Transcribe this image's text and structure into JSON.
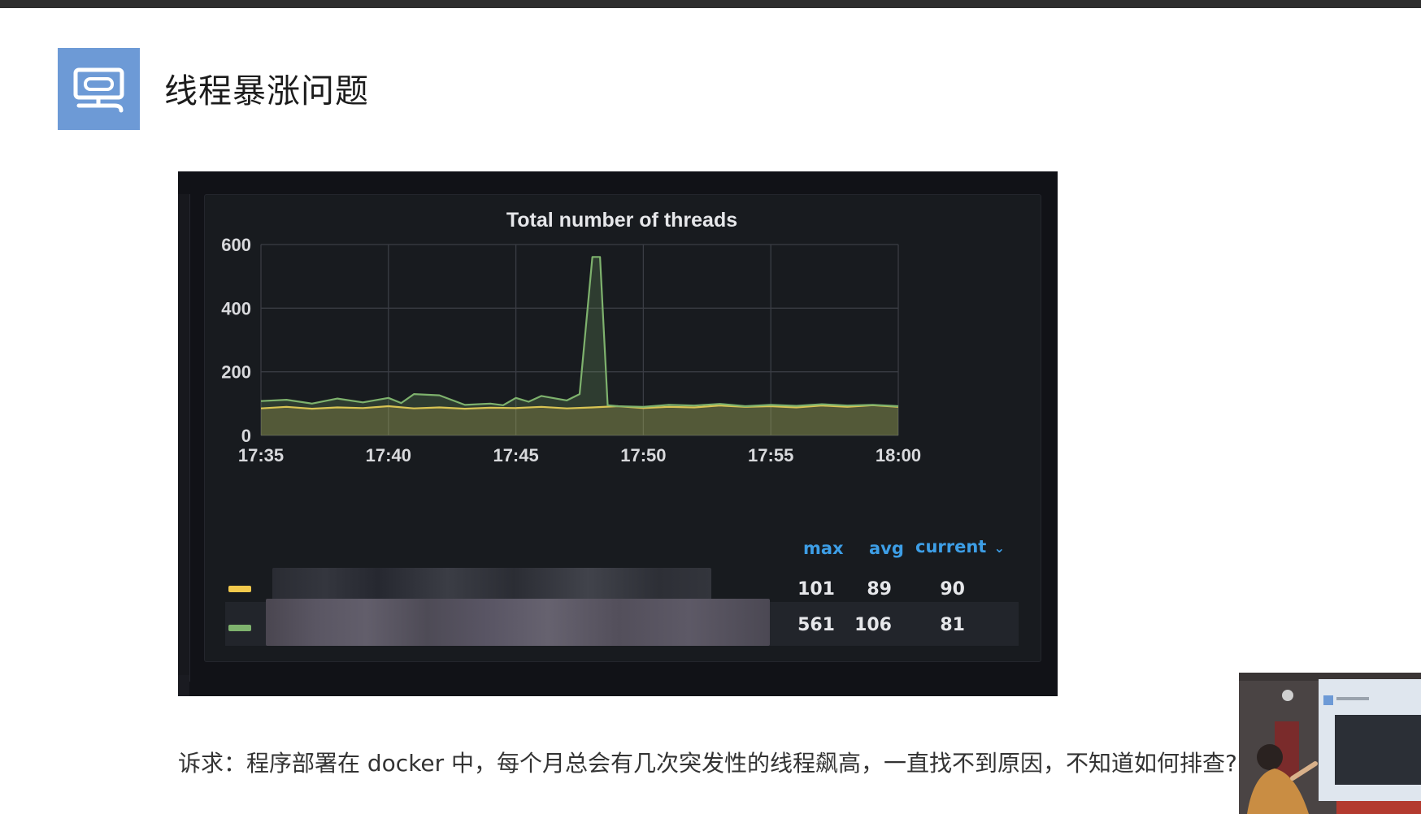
{
  "slide": {
    "title": "线程暴涨问题",
    "caption": "诉求：程序部署在 docker 中，每个月总会有几次突发性的线程飙高，一直找不到原因，不知道如何排查?"
  },
  "colors": {
    "logo_bg": "#6d9ad6",
    "dashboard_bg": "#111217",
    "panel_bg": "#181b1f",
    "series_yellow": "#f2c94c",
    "series_green": "#7eb26d",
    "legend_header": "#3d9ee6"
  },
  "icons": {
    "logo": "presentation-board-icon",
    "dropdown": "chevron-down-icon"
  },
  "legend": {
    "columns": [
      "max",
      "avg",
      "current"
    ],
    "rows": [
      {
        "color": "#f2c94c",
        "max": "101",
        "avg": "89",
        "current": "90"
      },
      {
        "color": "#7eb26d",
        "max": "561",
        "avg": "106",
        "current": "81"
      }
    ]
  },
  "chart_data": {
    "type": "area",
    "title": "Total number of threads",
    "xlabel": "",
    "ylabel": "",
    "x_ticks": [
      "17:35",
      "17:40",
      "17:45",
      "17:50",
      "17:55",
      "18:00"
    ],
    "y_ticks": [
      "0",
      "200",
      "400",
      "600"
    ],
    "ylim": [
      0,
      600
    ],
    "grid": true,
    "series": [
      {
        "color": "#f2c94c",
        "x": [
          "17:35",
          "17:36",
          "17:37",
          "17:38",
          "17:39",
          "17:40",
          "17:41",
          "17:42",
          "17:43",
          "17:44",
          "17:45",
          "17:46",
          "17:47",
          "17:48",
          "17:49",
          "17:50",
          "17:51",
          "17:52",
          "17:53",
          "17:54",
          "17:55",
          "17:56",
          "17:57",
          "17:58",
          "17:59",
          "18:00"
        ],
        "y": [
          85,
          90,
          84,
          88,
          86,
          92,
          85,
          88,
          84,
          87,
          86,
          90,
          85,
          88,
          92,
          86,
          90,
          88,
          94,
          90,
          92,
          88,
          94,
          90,
          95,
          90
        ]
      },
      {
        "color": "#7eb26d",
        "x": [
          "17:35",
          "17:36",
          "17:37",
          "17:38",
          "17:39",
          "17:40",
          "17:40.5",
          "17:41",
          "17:42",
          "17:43",
          "17:44",
          "17:44.5",
          "17:45",
          "17:45.5",
          "17:46",
          "17:47",
          "17:47.5",
          "17:48",
          "17:48.3",
          "17:48.6",
          "17:49",
          "17:50",
          "17:51",
          "17:52",
          "17:53",
          "17:54",
          "17:55",
          "17:56",
          "17:57",
          "17:58",
          "17:59",
          "18:00"
        ],
        "y": [
          108,
          112,
          100,
          116,
          104,
          118,
          102,
          130,
          126,
          96,
          100,
          95,
          118,
          106,
          124,
          110,
          130,
          561,
          561,
          95,
          92,
          90,
          96,
          94,
          99,
          92,
          96,
          93,
          98,
          94,
          96,
          92
        ]
      }
    ]
  }
}
